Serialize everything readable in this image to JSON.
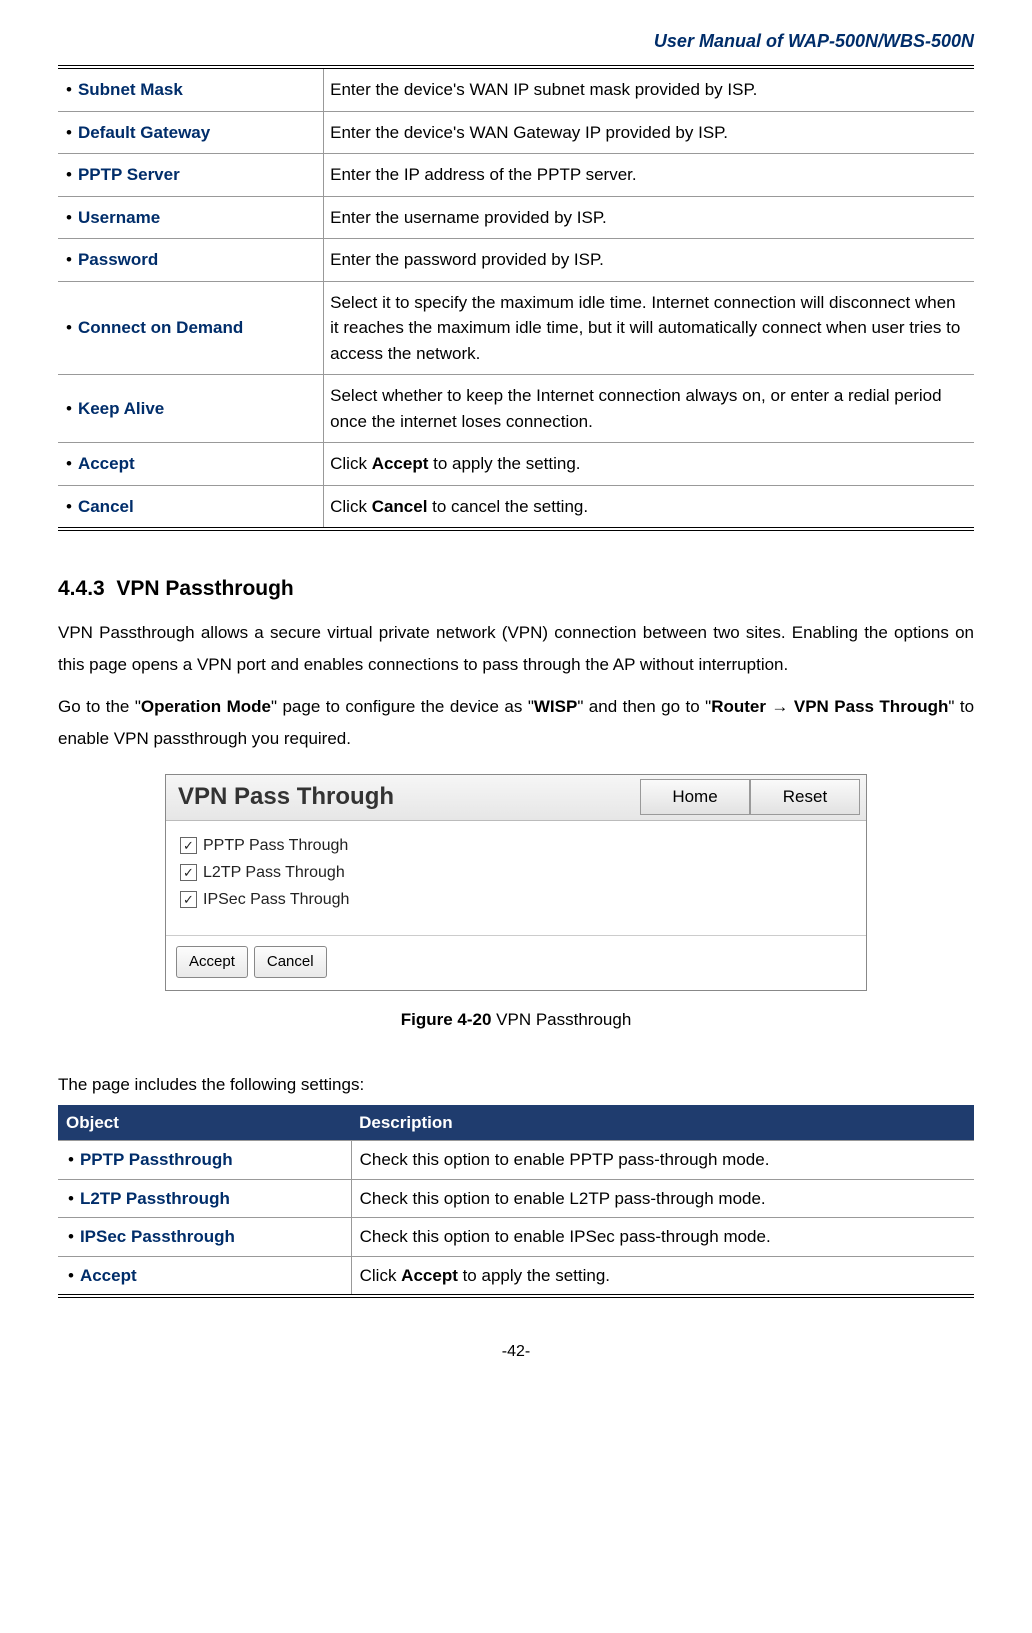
{
  "header": {
    "title": "User Manual of WAP-500N/WBS-500N"
  },
  "table1": {
    "rows": [
      {
        "name": "Subnet Mask",
        "desc": "Enter the device's WAN IP subnet mask provided by ISP."
      },
      {
        "name": "Default Gateway",
        "desc": "Enter the device's WAN Gateway IP provided by ISP."
      },
      {
        "name": "PPTP Server",
        "desc": "Enter the IP address of the PPTP server."
      },
      {
        "name": "Username",
        "desc": "Enter the username provided by ISP."
      },
      {
        "name": "Password",
        "desc": "Enter the password provided by ISP."
      },
      {
        "name": "Connect on Demand",
        "desc": "Select it to specify the maximum idle time. Internet connection will disconnect when it reaches the maximum idle time, but it will automatically connect when user tries to access the network."
      },
      {
        "name": "Keep Alive",
        "desc": "Select whether to keep the Internet connection always on, or enter a redial period once the internet loses connection."
      },
      {
        "name": "Accept",
        "desc_pre": "Click ",
        "desc_bold": "Accept",
        "desc_post": " to apply the setting."
      },
      {
        "name": "Cancel",
        "desc_pre": "Click ",
        "desc_bold": "Cancel",
        "desc_post": " to cancel the setting."
      }
    ]
  },
  "section": {
    "number": "4.4.3",
    "title": "VPN Passthrough",
    "para1": "VPN Passthrough allows a secure virtual private network (VPN) connection between two sites. Enabling the options on this page opens a VPN port and enables connections to pass through the AP without interruption.",
    "para2_pre": "Go to the \"",
    "para2_b1": "Operation Mode",
    "para2_mid1": "\" page to configure the device as \"",
    "para2_b2": "WISP",
    "para2_mid2": "\" and then go to \"",
    "para2_b3": "Router ",
    "para2_arrow": "→",
    "para2_b4": " VPN Pass Through",
    "para2_post": "\" to enable VPN passthrough you required."
  },
  "ui": {
    "title": "VPN Pass Through",
    "home": "Home",
    "reset": "Reset",
    "checks": [
      {
        "label": "PPTP Pass Through",
        "checked": true
      },
      {
        "label": "L2TP Pass Through",
        "checked": true
      },
      {
        "label": "IPSec Pass Through",
        "checked": true
      }
    ],
    "accept": "Accept",
    "cancel": "Cancel"
  },
  "figure": {
    "label": "Figure 4-20",
    "caption": " VPN Passthrough"
  },
  "intro2": "The page includes the following settings:",
  "table2": {
    "head_obj": "Object",
    "head_desc": "Description",
    "rows": [
      {
        "name": "PPTP Passthrough",
        "desc": "Check this option to enable PPTP pass-through mode."
      },
      {
        "name": "L2TP Passthrough",
        "desc": "Check this option to enable L2TP pass-through mode."
      },
      {
        "name": "IPSec Passthrough",
        "desc": "Check this option to enable IPSec pass-through mode."
      },
      {
        "name": "Accept",
        "desc_pre": "Click ",
        "desc_bold": "Accept",
        "desc_post": " to apply the setting."
      }
    ]
  },
  "footer": {
    "page": "-42-"
  }
}
